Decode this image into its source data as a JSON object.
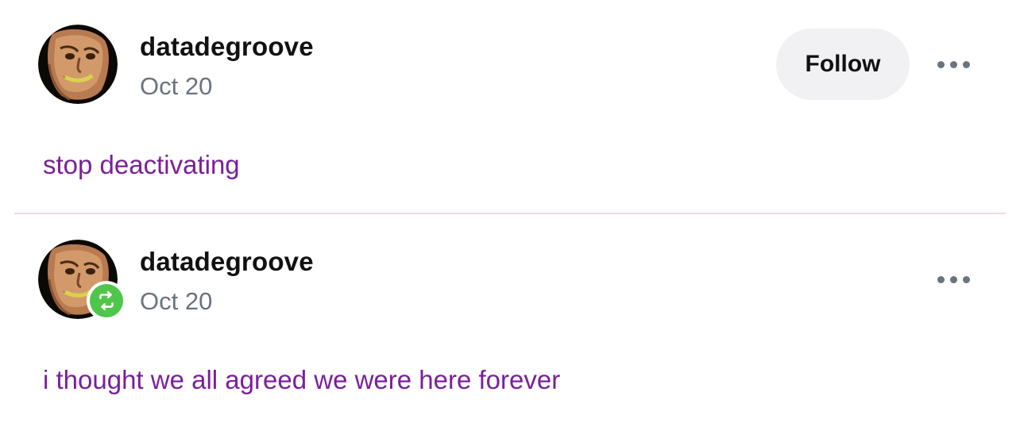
{
  "posts": [
    {
      "username": "datadegroove",
      "date": "Oct 20",
      "follow_label": "Follow",
      "text": "stop deactivating"
    },
    {
      "username": "datadegroove",
      "date": "Oct 20",
      "text": "i thought we all agreed we were here forever",
      "reblog_icon": "reblog-icon"
    }
  ],
  "colors": {
    "post_text": "#7b1f9a",
    "date_text": "#6b7280",
    "divider": "#ecd9ee",
    "follow_bg": "#f1f1f3",
    "reblog_badge": "#4fc64a"
  }
}
